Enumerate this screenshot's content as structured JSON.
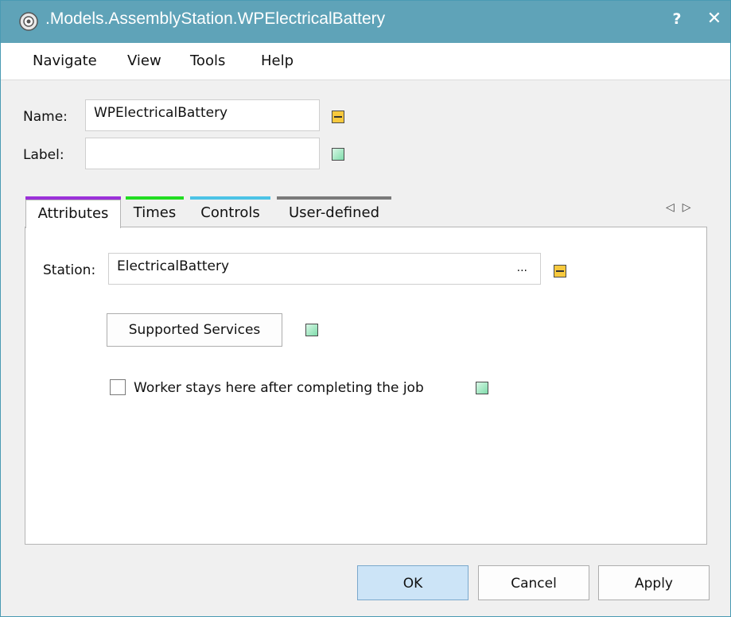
{
  "window": {
    "title": ".Models.AssemblyStation.WPElectricalBattery",
    "help_label": "?",
    "close_label": "✕",
    "app_icon": "gear-icon"
  },
  "menu": {
    "items": [
      "Navigate",
      "View",
      "Tools",
      "Help"
    ]
  },
  "form": {
    "name_label": "Name:",
    "name_value": "WPElectricalBattery",
    "label_label": "Label:",
    "label_value": ""
  },
  "tabs": [
    {
      "label": "Attributes",
      "color": "#9b30d9",
      "active": true
    },
    {
      "label": "Times",
      "color": "#22dd22",
      "active": false
    },
    {
      "label": "Controls",
      "color": "#4cc3e6",
      "active": false
    },
    {
      "label": "User-defined",
      "color": "#7a7a7a",
      "active": false
    }
  ],
  "tab_scroll": {
    "left": "◁",
    "right": "▷"
  },
  "attributes": {
    "station_label": "Station:",
    "station_value": "ElectricalBattery",
    "browse_label": "...",
    "supported_services_label": "Supported Services",
    "worker_stays_label": "Worker stays here after completing the job",
    "worker_stays_checked": false
  },
  "buttons": {
    "ok": "OK",
    "cancel": "Cancel",
    "apply": "Apply"
  },
  "colors": {
    "titlebar": "#5fa3b8",
    "indicator_inherited": "#f7c93e",
    "indicator_local": "#7fdcab"
  }
}
